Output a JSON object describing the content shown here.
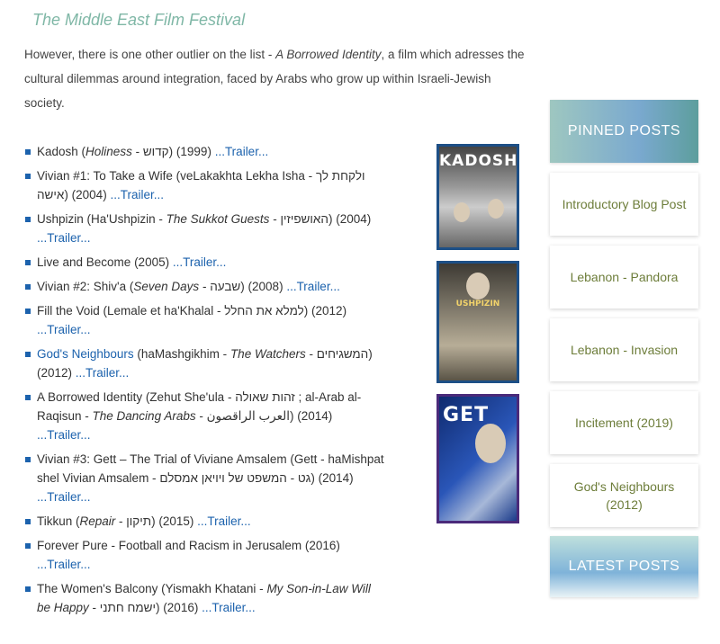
{
  "site_title": "The Middle East Film Festival",
  "intro": {
    "before": "However, there is one other outlier on the list - ",
    "em": "A Borrowed Identity",
    "after": ", a film which adresses the cultural dilemmas around integration, faced by Arabs who grow up within Israeli-Jewish society."
  },
  "trailer_label": "...Trailer...",
  "films": [
    {
      "a": "Kadosh (",
      "em": "Holiness",
      "b": " - קדוש) (1999) "
    },
    {
      "a": "Vivian #1: To Take a Wife (veLakakhta Lekha Isha - ולקחת לך אישה) (2004) "
    },
    {
      "a": "Ushpizin (Ha'Ushpizin - ",
      "em": "The Sukkot Guests",
      "b": " - האושפיזין) (2004) "
    },
    {
      "a": "Live and Become (2005) "
    },
    {
      "a": "Vivian #2: Shiv'a (",
      "em": "Seven Days",
      "b": " - שבעה) (2008) "
    },
    {
      "a": "Fill the Void (Lemale et ha'Khalal - למלא את החלל) (2012) "
    },
    {
      "link": "God's Neighbours",
      "a": " (haMashgikhim - ",
      "em": "The Watchers",
      "b": " - המשגיחים) (2012) "
    },
    {
      "a": "A Borrowed Identity (Zehut She'ula - זהות שאולה ; al-Arab al-Raqisun - ",
      "em": "The Dancing Arabs",
      "b": " - العرب الراقصون) (2014) "
    },
    {
      "a": "Vivian #3: Gett – The Trial of Viviane Amsalem (Gett - haMishpat shel Vivian Amsalem - גט - המשפט של ויויאן אמסלם) (2014) "
    },
    {
      "a": "Tikkun (",
      "em": "Repair",
      "b": " - תיקון) (2015) "
    },
    {
      "a": "Forever Pure - Football and Racism in Jerusalem (2016) "
    },
    {
      "a": "The Women's Balcony (Yismakh Khatani - ",
      "em": "My Son-in-Law Will be Happy",
      "b": " - ישמח חתני) (2016) "
    }
  ],
  "posters": [
    {
      "title": "KADOSH"
    },
    {
      "title": "USHPIZIN"
    },
    {
      "title": "GET"
    }
  ],
  "sidebar": {
    "pinned_heading": "PINNED POSTS",
    "items": [
      "Introductory Blog Post",
      "Lebanon - Pandora",
      "Lebanon - Invasion",
      "Incitement (2019)",
      "God's Neighbours (2012)"
    ],
    "latest_heading": "LATEST POSTS"
  },
  "colors": {
    "accent_link": "#1c62ad",
    "title": "#7fb7a6",
    "sidebar_text": "#6d7d3a"
  }
}
